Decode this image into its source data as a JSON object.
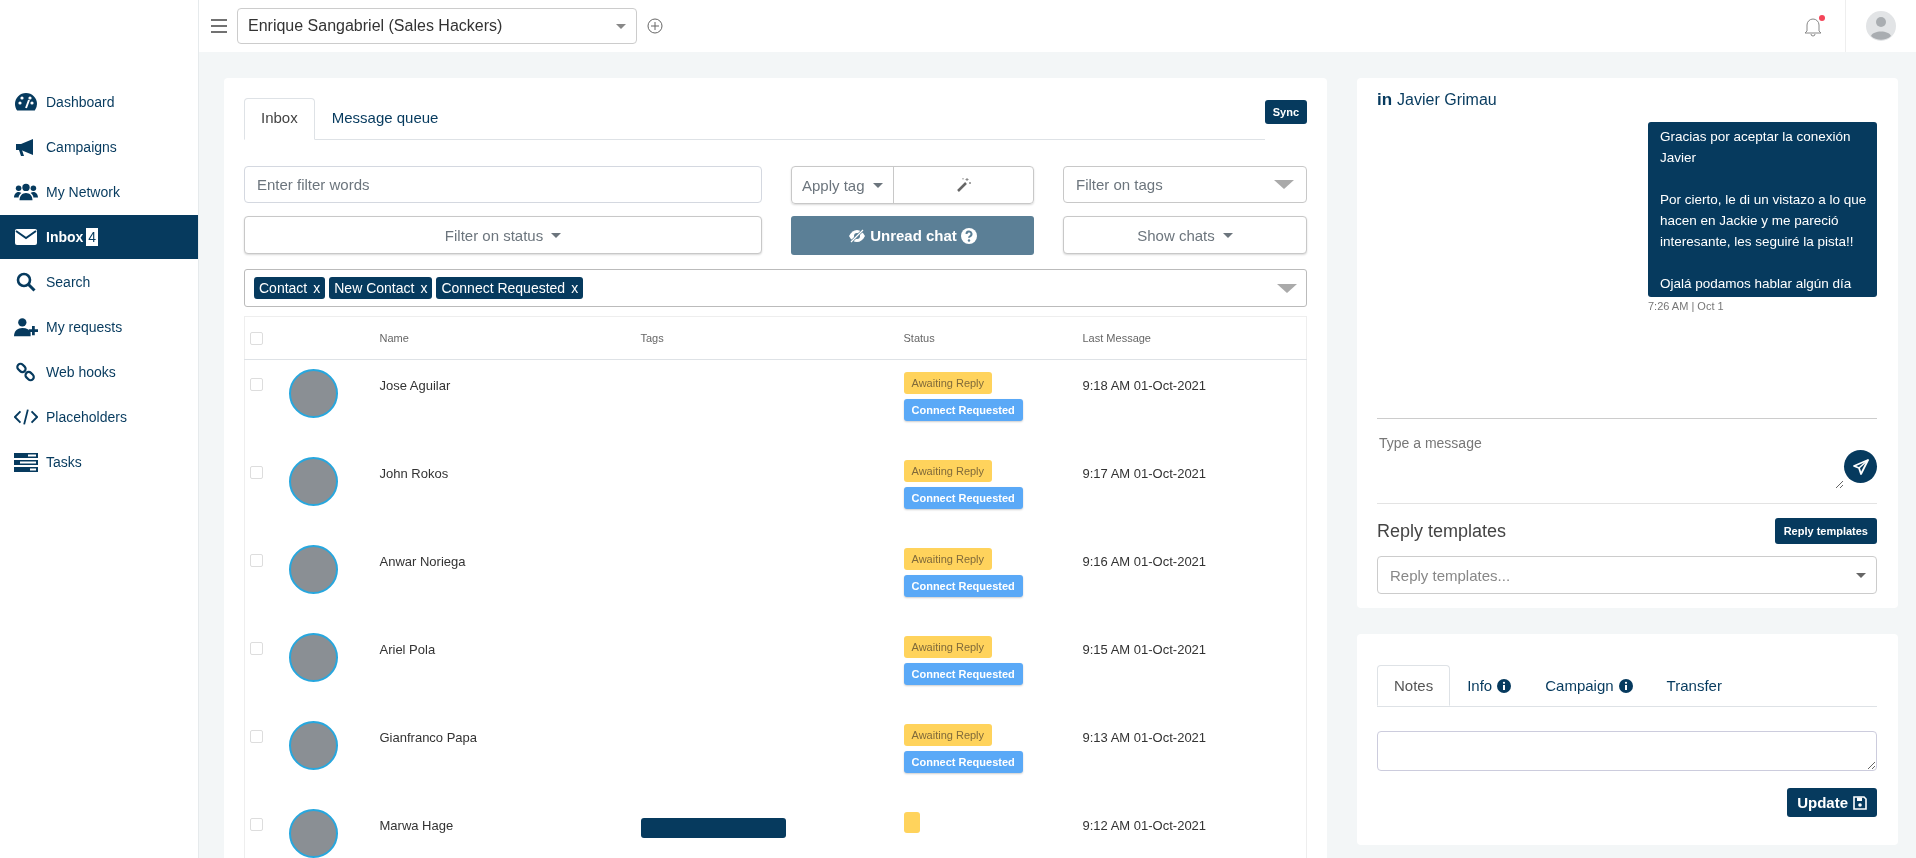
{
  "topbar": {
    "account": "Enrique Sangabriel (Sales Hackers)",
    "notification_unread": true
  },
  "sidebar": {
    "items": [
      {
        "label": "Dashboard",
        "selected": false
      },
      {
        "label": "Campaigns",
        "selected": false
      },
      {
        "label": "My Network",
        "selected": false
      },
      {
        "label": "Inbox",
        "selected": true,
        "badge": "4"
      },
      {
        "label": "Search",
        "selected": false
      },
      {
        "label": "My requests",
        "selected": false
      },
      {
        "label": "Web hooks",
        "selected": false
      },
      {
        "label": "Placeholders",
        "selected": false
      },
      {
        "label": "Tasks",
        "selected": false
      }
    ]
  },
  "inbox": {
    "tabs": [
      {
        "label": "Inbox",
        "selected": true
      },
      {
        "label": "Message queue",
        "selected": false
      }
    ],
    "sync_button": "Sync",
    "filter_words": {
      "placeholder": "Enter filter words"
    },
    "apply_tag": "Apply tag",
    "filter_tags": {
      "placeholder": "Filter on tags"
    },
    "filter_status": "Filter on status",
    "unread_chat": "Unread chat",
    "show_chats": "Show chats",
    "active_filters": [
      {
        "label": "Contact",
        "remove": "x"
      },
      {
        "label": "New Contact",
        "remove": "x"
      },
      {
        "label": "Connect Requested",
        "remove": "x"
      }
    ],
    "table": {
      "all_checked": false,
      "columns": [
        "Name",
        "Tags",
        "Status",
        "Last Message"
      ],
      "rows": [
        {
          "checked": false,
          "name": "Jose Aguilar",
          "tags": [],
          "statuses": [
            {
              "kind": "awaiting",
              "label": "Awaiting Reply"
            },
            {
              "kind": "connect",
              "label": "Connect Requested"
            }
          ],
          "last_message": "9:18 AM 01-Oct-2021"
        },
        {
          "checked": false,
          "name": "John Rokos",
          "tags": [],
          "statuses": [
            {
              "kind": "awaiting",
              "label": "Awaiting Reply"
            },
            {
              "kind": "connect",
              "label": "Connect Requested"
            }
          ],
          "last_message": "9:17 AM 01-Oct-2021"
        },
        {
          "checked": false,
          "name": "Anwar Noriega",
          "tags": [],
          "statuses": [
            {
              "kind": "awaiting",
              "label": "Awaiting Reply"
            },
            {
              "kind": "connect",
              "label": "Connect Requested"
            }
          ],
          "last_message": "9:16 AM 01-Oct-2021"
        },
        {
          "checked": false,
          "name": "Ariel Pola",
          "tags": [],
          "statuses": [
            {
              "kind": "awaiting",
              "label": "Awaiting Reply"
            },
            {
              "kind": "connect",
              "label": "Connect Requested"
            }
          ],
          "last_message": "9:15 AM 01-Oct-2021"
        },
        {
          "checked": false,
          "name": "Gianfranco Papa",
          "tags": [],
          "statuses": [
            {
              "kind": "awaiting",
              "label": "Awaiting Reply"
            },
            {
              "kind": "connect",
              "label": "Connect Requested"
            }
          ],
          "last_message": "9:13 AM 01-Oct-2021"
        },
        {
          "checked": false,
          "name": "Marwa Hage",
          "tags": [
            {
              "kind": "tag"
            }
          ],
          "statuses": [
            {
              "kind": "awaiting"
            }
          ],
          "last_message": "9:12 AM 01-Oct-2021"
        }
      ]
    }
  },
  "chat": {
    "network_badge": "in",
    "contact": "Javier Grimau",
    "messages": [
      {
        "text": "Gracias por aceptar la conexión Javier\n\nPor cierto, le di un vistazo a lo que hacen en Jackie y me pareció interesante, les seguiré la pista!!\n\nOjalá podamos hablar algún día",
        "time": "7:26 AM | Oct 1"
      }
    ],
    "compose": {
      "placeholder": "Type a message"
    },
    "reply_templates": {
      "title": "Reply templates",
      "button": "Reply templates",
      "placeholder": "Reply templates..."
    }
  },
  "details": {
    "tabs": [
      {
        "label": "Notes",
        "selected": true,
        "info": false
      },
      {
        "label": "Info",
        "selected": false,
        "info": true
      },
      {
        "label": "Campaign",
        "selected": false,
        "info": true
      },
      {
        "label": "Transfer",
        "selected": false,
        "info": false
      }
    ],
    "update_button": "Update"
  }
}
